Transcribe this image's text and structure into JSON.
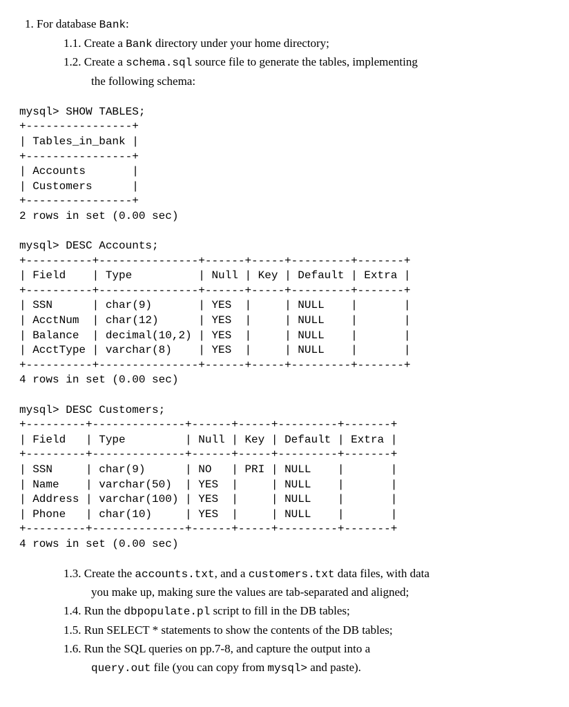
{
  "item1_num": "1.",
  "item1_pre": "For database ",
  "item1_code": "Bank",
  "item1_post": ":",
  "item11_num": "1.1.",
  "item11_pre": "Create a ",
  "item11_code": "Bank",
  "item11_post": " directory under your home directory;",
  "item12_num": "1.2.",
  "item12_pre": "Create a ",
  "item12_code": "schema.sql",
  "item12_post": " source file to generate the tables, implementing",
  "item12_cont": "the following schema:",
  "sql1": "mysql> SHOW TABLES;\n+----------------+\n| Tables_in_bank |\n+----------------+\n| Accounts       |\n| Customers      |\n+----------------+\n2 rows in set (0.00 sec)\n\nmysql> DESC Accounts;\n+----------+---------------+------+-----+---------+-------+\n| Field    | Type          | Null | Key | Default | Extra |\n+----------+---------------+------+-----+---------+-------+\n| SSN      | char(9)       | YES  |     | NULL    |       |\n| AcctNum  | char(12)      | YES  |     | NULL    |       |\n| Balance  | decimal(10,2) | YES  |     | NULL    |       |\n| AcctType | varchar(8)    | YES  |     | NULL    |       |\n+----------+---------------+------+-----+---------+-------+\n4 rows in set (0.00 sec)\n\nmysql> DESC Customers;\n+---------+--------------+------+-----+---------+-------+\n| Field   | Type         | Null | Key | Default | Extra |\n+---------+--------------+------+-----+---------+-------+\n| SSN     | char(9)      | NO   | PRI | NULL    |       |\n| Name    | varchar(50)  | YES  |     | NULL    |       |\n| Address | varchar(100) | YES  |     | NULL    |       |\n| Phone   | char(10)     | YES  |     | NULL    |       |\n+---------+--------------+------+-----+---------+-------+\n4 rows in set (0.00 sec)",
  "item13_num": "1.3.",
  "item13_a": "Create the ",
  "item13_code1": "accounts.txt",
  "item13_b": ", and a ",
  "item13_code2": "customers.txt",
  "item13_c": " data files, with data",
  "item13_cont": "you make up, making sure the values are tab-separated and aligned;",
  "item14_num": "1.4.",
  "item14_a": "Run the ",
  "item14_code": "dbpopulate.pl",
  "item14_b": " script to fill in the DB tables;",
  "item15_num": "1.5.",
  "item15_text": "Run SELECT * statements to show the contents of the DB tables;",
  "item16_num": "1.6.",
  "item16_text": "Run the SQL queries on pp.7-8, and capture the output into a",
  "item16_code": "query.out",
  "item16_b": " file (you can copy from ",
  "item16_code2": "mysql>",
  "item16_c": " and paste)."
}
